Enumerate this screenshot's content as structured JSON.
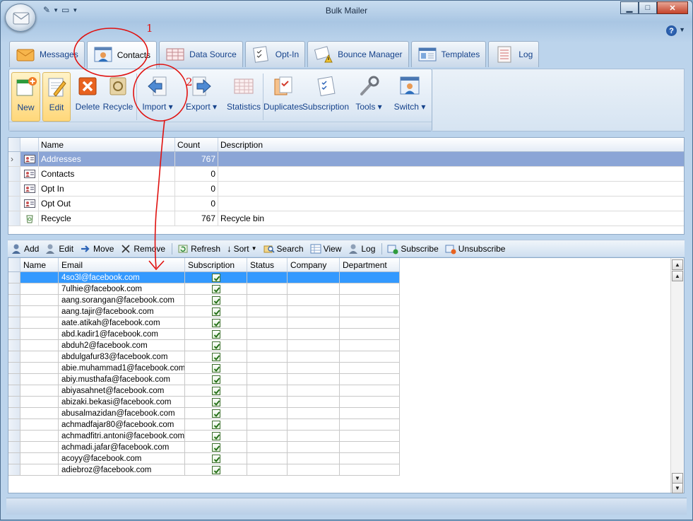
{
  "window": {
    "title": "Bulk Mailer"
  },
  "title_controls": {
    "minimize": "▁",
    "maximize": "□",
    "close": "✕"
  },
  "tabs": [
    {
      "label": "Messages",
      "icon": "envelope-icon"
    },
    {
      "label": "Contacts",
      "icon": "contacts-icon",
      "active": true
    },
    {
      "label": "Data Source",
      "icon": "table-icon"
    },
    {
      "label": "Opt-In",
      "icon": "checklist-icon"
    },
    {
      "label": "Bounce Manager",
      "icon": "warning-mail-icon"
    },
    {
      "label": "Templates",
      "icon": "templates-icon"
    },
    {
      "label": "Log",
      "icon": "log-icon"
    }
  ],
  "ribbon": {
    "new": "New",
    "edit": "Edit",
    "delete": "Delete",
    "recycle": "Recycle",
    "import": "Import",
    "export": "Export",
    "statistics": "Statistics",
    "duplicates": "Duplicates",
    "subscription": "Subscription",
    "tools": "Tools",
    "switch": "Switch"
  },
  "groups_grid": {
    "columns": [
      "Name",
      "Count",
      "Description"
    ],
    "rows": [
      {
        "name": "Addresses",
        "count": "767",
        "description": ""
      },
      {
        "name": "Contacts",
        "count": "0",
        "description": ""
      },
      {
        "name": "Opt In",
        "count": "0",
        "description": ""
      },
      {
        "name": "Opt Out",
        "count": "0",
        "description": ""
      },
      {
        "name": "Recycle",
        "count": "767",
        "description": "Recycle bin"
      }
    ]
  },
  "contacts_toolbar": {
    "add": "Add",
    "edit": "Edit",
    "move": "Move",
    "remove": "Remove",
    "refresh": "Refresh",
    "sort": "Sort",
    "search": "Search",
    "view": "View",
    "log": "Log",
    "subscribe": "Subscribe",
    "unsubscribe": "Unsubscribe"
  },
  "contacts_grid": {
    "columns": [
      "Name",
      "Email",
      "Subscription",
      "Status",
      "Company",
      "Department"
    ],
    "rows": [
      "4so3l@facebook.com",
      "7ulhie@facebook.com",
      "aang.sorangan@facebook.com",
      "aang.tajir@facebook.com",
      "aate.atikah@facebook.com",
      "abd.kadir1@facebook.com",
      "abduh2@facebook.com",
      "abdulgafur83@facebook.com",
      "abie.muhammad1@facebook.com",
      "abiy.musthafa@facebook.com",
      "abiyasahnet@facebook.com",
      "abizaki.bekasi@facebook.com",
      "abusalmazidan@facebook.com",
      "achmadfajar80@facebook.com",
      "achmadfitri.antoni@facebook.com",
      "achmadi.jafar@facebook.com",
      "acoyy@facebook.com",
      "adiebroz@facebook.com"
    ]
  },
  "annotations": {
    "num1": "1",
    "num2": "2"
  },
  "colors": {
    "accent": "#15428b",
    "selection": "#3399ff",
    "annotation": "#e0110f"
  }
}
